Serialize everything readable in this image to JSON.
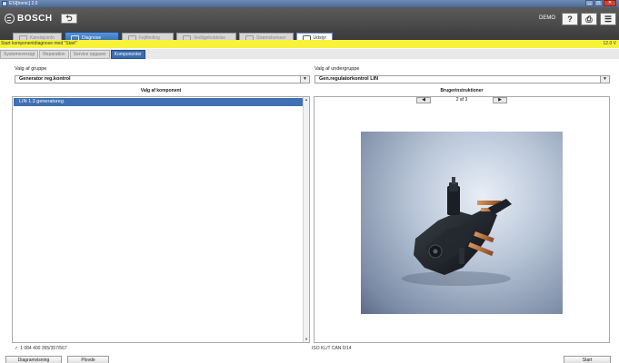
{
  "window": {
    "title": "ESI[tronic] 2.0",
    "buttons": [
      "_",
      "□",
      "✕"
    ]
  },
  "header": {
    "brand": "BOSCH",
    "back_icon": "back-arrow-icon",
    "demo_label": "DEMO",
    "help_icon": "help-icon",
    "print_icon": "print-icon",
    "menu_icon": "menu-icon"
  },
  "tabs": [
    {
      "label": "Køretøjsinfo",
      "icon": "car-info-icon",
      "state": "disabled"
    },
    {
      "label": "Diagnose",
      "icon": "diagnose-icon",
      "state": "active"
    },
    {
      "label": "Fejlfinding",
      "icon": "troubleshoot-icon",
      "state": "disabled"
    },
    {
      "label": "Vedligeholdelse",
      "icon": "maintenance-icon",
      "state": "disabled"
    },
    {
      "label": "Strømskemaer",
      "icon": "wiring-icon",
      "state": "disabled"
    },
    {
      "label": "Udstyr",
      "icon": "equipment-icon",
      "state": "normal"
    }
  ],
  "status": {
    "message": "Start komponentdiagnose med \"Start\"",
    "voltage": "12.0 V",
    "color": "#f7f33a"
  },
  "subtabs": [
    {
      "label": "Systemoversigt",
      "active": false
    },
    {
      "label": "Reparation",
      "active": false
    },
    {
      "label": "Service opgaver",
      "active": false
    },
    {
      "label": "Komponenter",
      "active": true
    }
  ],
  "left": {
    "group_label": "Valg af gruppe",
    "group_value": "Generator reg.kontrol",
    "list_header": "Valg af komponent",
    "list_items": [
      "LIN 1.3 generatoreg."
    ]
  },
  "right": {
    "subgroup_label": "Valg af undergruppe",
    "subgroup_value": "Gen.regulatorkontrol LIN",
    "instructions_header": "Brugerinstruktioner",
    "page_indicator": "2 af 3",
    "prev_icon": "arrow-left-icon",
    "next_icon": "arrow-right-icon",
    "image_subject": "voltage-regulator-photo"
  },
  "footer": {
    "part_number": "1 084 400 355/357/567",
    "iso_info": "ISO KL/T CAN 0/14",
    "buttons": {
      "diagram": "Diagramvisning",
      "print": "Plovde",
      "start": "Start"
    }
  },
  "colors": {
    "accent": "#3c6eb0",
    "header_bg": "#4a4a4a",
    "status_bg": "#f7f33a"
  }
}
